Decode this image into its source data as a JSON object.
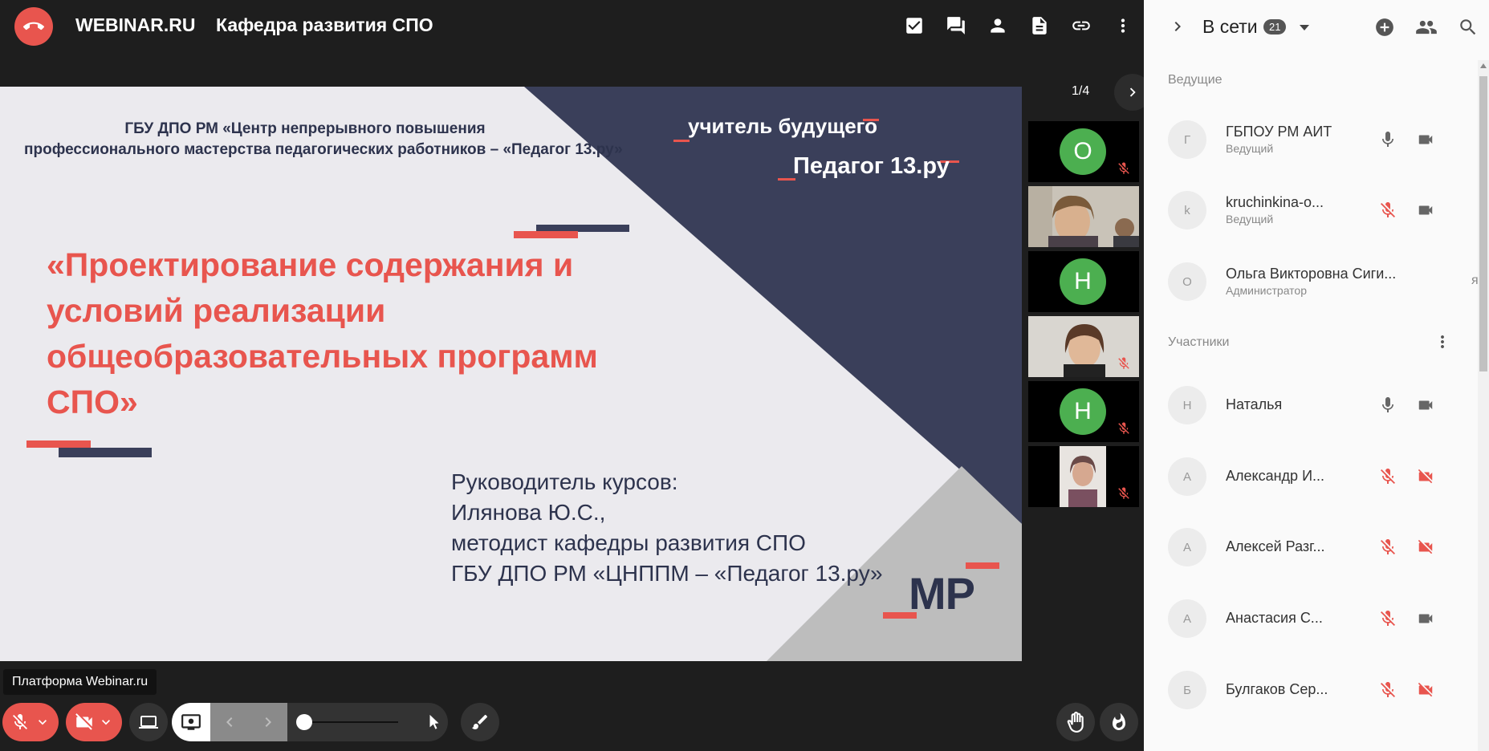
{
  "app": {
    "brand": "WEBINAR.RU",
    "title": "Кафедра развития СПО"
  },
  "top_icons": [
    "tasks-icon",
    "chat-icon",
    "person-icon",
    "file-icon",
    "link-icon",
    "more-vert-icon"
  ],
  "slide": {
    "org_line1": "ГБУ ДПО РМ  «Центр непрерывного повышения",
    "org_line2": "профессионального мастерства педагогических работников – «Педагог 13.ру»",
    "tagline1": "учитель будущего",
    "tagline2": "Педагог 13.ру",
    "title_line1": "«Проектирование содержания и",
    "title_line2": "условий реализации",
    "title_line3": "общеобразовательных программ",
    "title_line4": "СПО»",
    "course_line1": "Руководитель курсов:",
    "course_line2": "Илянова Ю.С.,",
    "course_line3": "методист кафедры развития СПО",
    "course_line4": "ГБУ ДПО РМ «ЦНППМ – «Педагог 13.ру»",
    "logo": "МР",
    "colors": {
      "navy": "#3a3f5a",
      "red": "#e8554e",
      "gray": "#bdbdbd"
    }
  },
  "pager": {
    "text": "1/4"
  },
  "thumbs": [
    {
      "letter": "О",
      "muted": true
    },
    {
      "letter": "",
      "muted": false
    },
    {
      "letter": "Н",
      "muted": false
    },
    {
      "letter": "",
      "muted": true
    },
    {
      "letter": "Н",
      "muted": true
    },
    {
      "letter": "",
      "muted": true
    }
  ],
  "tooltip": "Платформа Webinar.ru",
  "panel": {
    "online_label": "В сети",
    "online_count": "21",
    "presenters_label": "Ведущие",
    "participants_label": "Участники",
    "presenters": [
      {
        "initial": "Г",
        "name": "ГБПОУ РМ АИТ",
        "role": "Ведущий"
      },
      {
        "initial": "k",
        "name": "kruchinkina-o...",
        "role": "Ведущий"
      },
      {
        "initial": "О",
        "name": "Ольга Викторовна Сиги...",
        "role": "Администратор",
        "extra": "я"
      }
    ],
    "participants": [
      {
        "initial": "Н",
        "name": "Наталья"
      },
      {
        "initial": "А",
        "name": "Александр И..."
      },
      {
        "initial": "А",
        "name": "Алексей Разг..."
      },
      {
        "initial": "А",
        "name": "Анастасия С..."
      },
      {
        "initial": "Б",
        "name": "Булгаков Сер..."
      }
    ]
  }
}
